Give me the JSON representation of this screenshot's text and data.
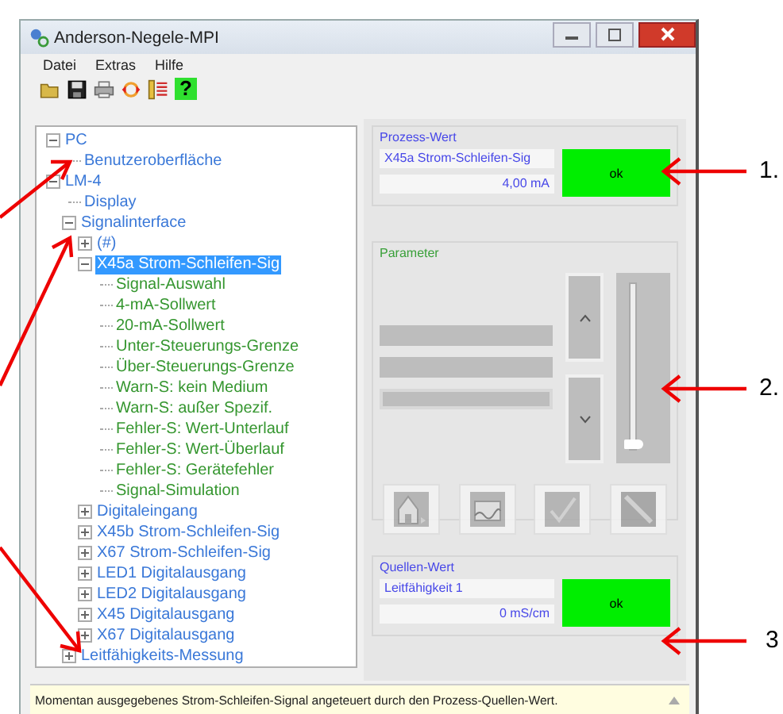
{
  "window": {
    "title": "Anderson-Negele-MPI"
  },
  "menu": [
    "Datei",
    "Extras",
    "Hilfe"
  ],
  "toolbar": {
    "help_label": "?"
  },
  "tree": [
    {
      "label": "PC",
      "kind": "group",
      "expanded": true,
      "selected": false,
      "children": [
        {
          "label": "Benutzeroberfläche",
          "kind": "group",
          "selected": false
        }
      ]
    },
    {
      "label": "LM-4",
      "kind": "group",
      "expanded": true,
      "selected": false,
      "children": [
        {
          "label": "Display",
          "kind": "group",
          "selected": false
        },
        {
          "label": "Signalinterface",
          "kind": "group",
          "expanded": true,
          "selected": false,
          "children": [
            {
              "label": "(#)",
              "kind": "group",
              "expanded": false,
              "selected": false
            },
            {
              "label": "X45a Strom-Schleifen-Sig",
              "kind": "group",
              "expanded": true,
              "selected": true,
              "children": [
                {
                  "label": "Signal-Auswahl",
                  "kind": "parameter",
                  "selected": false
                },
                {
                  "label": "4-mA-Sollwert",
                  "kind": "parameter",
                  "selected": false
                },
                {
                  "label": "20-mA-Sollwert",
                  "kind": "parameter",
                  "selected": false
                },
                {
                  "label": "Unter-Steuerungs-Grenze",
                  "kind": "parameter",
                  "selected": false
                },
                {
                  "label": "Über-Steuerungs-Grenze",
                  "kind": "parameter",
                  "selected": false
                },
                {
                  "label": "Warn-S: kein Medium",
                  "kind": "parameter",
                  "selected": false
                },
                {
                  "label": "Warn-S: außer Spezif.",
                  "kind": "parameter",
                  "selected": false
                },
                {
                  "label": "Fehler-S: Wert-Unterlauf",
                  "kind": "parameter",
                  "selected": false
                },
                {
                  "label": "Fehler-S: Wert-Überlauf",
                  "kind": "parameter",
                  "selected": false
                },
                {
                  "label": "Fehler-S: Gerätefehler",
                  "kind": "parameter",
                  "selected": false
                },
                {
                  "label": "Signal-Simulation",
                  "kind": "parameter",
                  "selected": false
                }
              ]
            },
            {
              "label": "Digitaleingang",
              "kind": "group",
              "expanded": false,
              "selected": false
            },
            {
              "label": "X45b Strom-Schleifen-Sig",
              "kind": "group",
              "expanded": false,
              "selected": false
            },
            {
              "label": "X67 Strom-Schleifen-Sig",
              "kind": "group",
              "expanded": false,
              "selected": false
            },
            {
              "label": "LED1 Digitalausgang",
              "kind": "group",
              "expanded": false,
              "selected": false
            },
            {
              "label": "LED2 Digitalausgang",
              "kind": "group",
              "expanded": false,
              "selected": false
            },
            {
              "label": "X45 Digitalausgang",
              "kind": "group",
              "expanded": false,
              "selected": false
            },
            {
              "label": "X67 Digitalausgang",
              "kind": "group",
              "expanded": false,
              "selected": false
            }
          ]
        },
        {
          "label": "Leitfähigkeits-Messung",
          "kind": "group",
          "expanded": false,
          "selected": false
        }
      ]
    }
  ],
  "process_value": {
    "title": "Prozess-Wert",
    "name": "X45a Strom-Schleifen-Sig",
    "value": "4,00 mA",
    "status": "ok"
  },
  "parameter": {
    "title": "Parameter",
    "fields": [
      {
        "disabled": true
      },
      {
        "disabled": true
      },
      {
        "disabled": true
      }
    ],
    "slider": {
      "level": 0,
      "disabled": true
    },
    "tool_buttons": [
      {
        "kind": "home",
        "disabled": true
      },
      {
        "kind": "chart",
        "disabled": true
      },
      {
        "kind": "check",
        "disabled": true
      },
      {
        "kind": "pen",
        "disabled": true
      }
    ]
  },
  "source_value": {
    "title": "Quellen-Wert",
    "name": "Leitfähigkeit 1",
    "value": "0 mS/cm",
    "status": "ok"
  },
  "status_bar": "Momentan ausgegebenes Strom-Schleifen-Signal angeteuert durch den Prozess-Quellen-Wert.",
  "annotations": [
    {
      "label": "1."
    },
    {
      "label": "2."
    },
    {
      "label": "3"
    }
  ]
}
